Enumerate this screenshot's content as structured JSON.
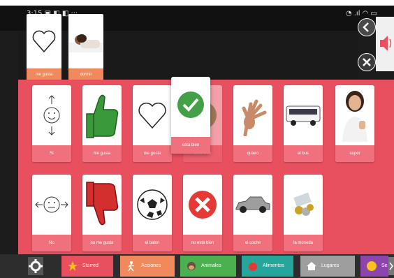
{
  "status": {
    "time": "3:15",
    "left_icons": "▣ ◧ ◧ ···",
    "right_icons": "◔ .ıl ◠ ▭"
  },
  "sentence": [
    {
      "label": "me gusta",
      "icon": "heart-outline-icon"
    },
    {
      "label": "dormir",
      "icon": "sleeping-person-icon"
    }
  ],
  "board": {
    "row1": [
      {
        "label": "Sí",
        "icon": "smiley-nod-icon"
      },
      {
        "label": "me gusta",
        "icon": "thumbs-up-icon"
      },
      {
        "label": "me gusta",
        "icon": "heart-outline-icon"
      },
      {
        "label": "está bien",
        "icon": "check-icon"
      },
      {
        "label": "quiero",
        "icon": "reaching-hand-icon"
      },
      {
        "label": "el bus",
        "icon": "bus-icon"
      },
      {
        "label": "super",
        "icon": "thumbs-up-woman-icon"
      }
    ],
    "row2": [
      {
        "label": "No",
        "icon": "smiley-shake-icon"
      },
      {
        "label": "no me gusta",
        "icon": "thumbs-down-icon"
      },
      {
        "label": "el balon",
        "icon": "soccer-ball-icon"
      },
      {
        "label": "no está bien",
        "icon": "x-circle-icon"
      },
      {
        "label": "el coche",
        "icon": "car-icon"
      },
      {
        "label": "la moneda",
        "icon": "coins-icon"
      }
    ]
  },
  "dragging": {
    "label": "está bien",
    "icon": "check-icon"
  },
  "tabs": [
    {
      "label": "Starred",
      "color": "#e8505f",
      "icon": "star-icon"
    },
    {
      "label": "Acciones",
      "color": "#f08a5d",
      "icon": "action-figure-icon"
    },
    {
      "label": "Animales",
      "color": "#4caf50",
      "icon": "monkey-icon"
    },
    {
      "label": "Alimentos",
      "color": "#26a69a",
      "icon": "apple-icon"
    },
    {
      "label": "Lugares",
      "color": "#9e9e9e",
      "icon": "house-icon"
    },
    {
      "label": "Se",
      "color": "#8e44ad",
      "icon": "smiley-icon"
    }
  ],
  "colors": {
    "board_bg": "#e8505f",
    "card_label_bg": "#f0707d",
    "strip_label_bg": "#f08a5d",
    "top_bar": "#111111"
  }
}
